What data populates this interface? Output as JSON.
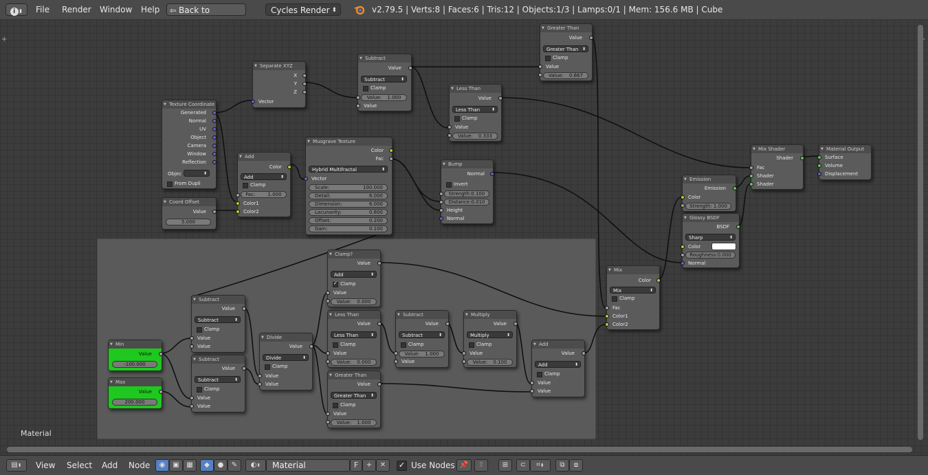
{
  "header": {
    "info_icon": "info-icon",
    "menus": [
      "File",
      "Render",
      "Window",
      "Help"
    ],
    "back_button": "Back to Previous",
    "render_engine": "Cycles Render",
    "stats": "v2.79.5 | Verts:8 | Faces:6 | Tris:12 | Objects:1/3 | Lamps:0/1 | Mem: 156.6 MB | Cube"
  },
  "frame": {
    "label": "Material"
  },
  "nodes": {
    "tex_coord": {
      "title": "Texture Coordinate",
      "outputs": [
        "Generated",
        "Normal",
        "UV",
        "Object",
        "Camera",
        "Window",
        "Reflection"
      ],
      "object_label": "Objec",
      "from_dupli": "From Dupli"
    },
    "coord_offset": {
      "title": "Coord Offset",
      "out": "Value",
      "value": "5.000"
    },
    "add1": {
      "title": "Add",
      "out": "Color",
      "mode": "Add",
      "clamp": "Clamp",
      "fac": "Fac:",
      "fac_val": "1.000",
      "in1": "Color1",
      "in2": "Color2"
    },
    "sepxyz": {
      "title": "Separate XYZ",
      "x": "X",
      "y": "Y",
      "z": "Z",
      "vec": "Vector"
    },
    "musgrave": {
      "title": "Musgrave Texture",
      "out_color": "Color",
      "out_fac": "Fac",
      "type": "Hybrid Multifractal",
      "vector": "Vector",
      "params": [
        [
          "Scale:",
          "100.000"
        ],
        [
          "Detail:",
          "6.000"
        ],
        [
          "Dimension:",
          "6.000"
        ],
        [
          "Lacunarity:",
          "0.800"
        ],
        [
          "Offset:",
          "0.200"
        ],
        [
          "Gain:",
          "0.100"
        ]
      ]
    },
    "subtract_top": {
      "title": "Subtract",
      "out": "Value",
      "mode": "Subtract",
      "clamp": "Clamp",
      "field": "Value:",
      "field_val": "1.000",
      "in": "Value"
    },
    "less_top": {
      "title": "Less Than",
      "out": "Value",
      "mode": "Less Than",
      "clamp": "Clamp",
      "in": "Value",
      "field": "Value:",
      "field_val": "0.333"
    },
    "greater_top": {
      "title": "Greater Than",
      "out": "Value",
      "mode": "Greater Than",
      "clamp": "Clamp",
      "in": "Value",
      "field": "Value:",
      "field_val": "0.667"
    },
    "bump": {
      "title": "Bump",
      "out": "Normal",
      "invert": "Invert",
      "strength": "Strength:",
      "strength_val": "0.100",
      "distance": "Distance:",
      "distance_val": "0.010",
      "height": "Height",
      "normal": "Normal"
    },
    "emission": {
      "title": "Emission",
      "out": "Emission",
      "color": "Color",
      "strength": "Strength:",
      "strength_val": "1.000"
    },
    "glossy": {
      "title": "Glossy BSDF",
      "out": "BSDF",
      "dist": "Sharp",
      "color": "Color",
      "rough": "Roughness:",
      "rough_val": "0.000",
      "normal": "Normal"
    },
    "mix_shader": {
      "title": "Mix Shader",
      "out": "Shader",
      "fac": "Fac",
      "s1": "Shader",
      "s2": "Shader"
    },
    "mat_out": {
      "title": "Material Output",
      "surface": "Surface",
      "volume": "Volume",
      "disp": "Displacement"
    },
    "mix": {
      "title": "Mix",
      "out": "Color",
      "mode": "Mix",
      "clamp": "Clamp",
      "fac": "Fac",
      "c1": "Color1",
      "c2": "Color2"
    },
    "min": {
      "title": "Min",
      "out": "Value",
      "value": "-100.000"
    },
    "max": {
      "title": "Max",
      "out": "Value",
      "value": "200.000"
    },
    "sub_a": {
      "title": "Subtract",
      "out": "Value",
      "mode": "Subtract",
      "clamp": "Clamp",
      "in1": "Value",
      "in2": "Value"
    },
    "sub_b": {
      "title": "Subtract",
      "out": "Value",
      "mode": "Subtract",
      "clamp": "Clamp",
      "in1": "Value",
      "in2": "Value"
    },
    "divide": {
      "title": "Divide",
      "out": "Value",
      "mode": "Divide",
      "clamp": "Clamp",
      "in1": "Value",
      "in2": "Value"
    },
    "clamp": {
      "title": "Clamp?",
      "out": "Value",
      "mode": "Add",
      "clamp": "Clamp",
      "in": "Value",
      "field": "Value:",
      "field_val": "0.000"
    },
    "less_bot": {
      "title": "Less Than",
      "out": "Value",
      "mode": "Less Than",
      "clamp": "Clamp",
      "in": "Value",
      "field": "Value:",
      "field_val": "0.000"
    },
    "greater_bot": {
      "title": "Greater Than",
      "out": "Value",
      "mode": "Greater Than",
      "clamp": "Clamp",
      "in": "Value",
      "field": "Value:",
      "field_val": "1.000"
    },
    "sub_c": {
      "title": "Subtract",
      "out": "Value",
      "mode": "Subtract",
      "clamp": "Clamp",
      "field": "Value:",
      "field_val": "1.000",
      "in": "Value"
    },
    "multiply": {
      "title": "Multiply",
      "out": "Value",
      "mode": "Multiply",
      "clamp": "Clamp",
      "in": "Value",
      "field": "Value:",
      "field_val": "0.100"
    },
    "add_bot": {
      "title": "Add",
      "out": "Value",
      "mode": "Add",
      "clamp": "Clamp",
      "in1": "Value",
      "in2": "Value"
    }
  },
  "footer": {
    "menus": [
      "View",
      "Select",
      "Add",
      "Node"
    ],
    "material_name": "Material",
    "fake_user": "F",
    "use_nodes": "Use Nodes"
  },
  "colors": {
    "value_node": "#1ec81e",
    "accent": "#5680c2"
  }
}
